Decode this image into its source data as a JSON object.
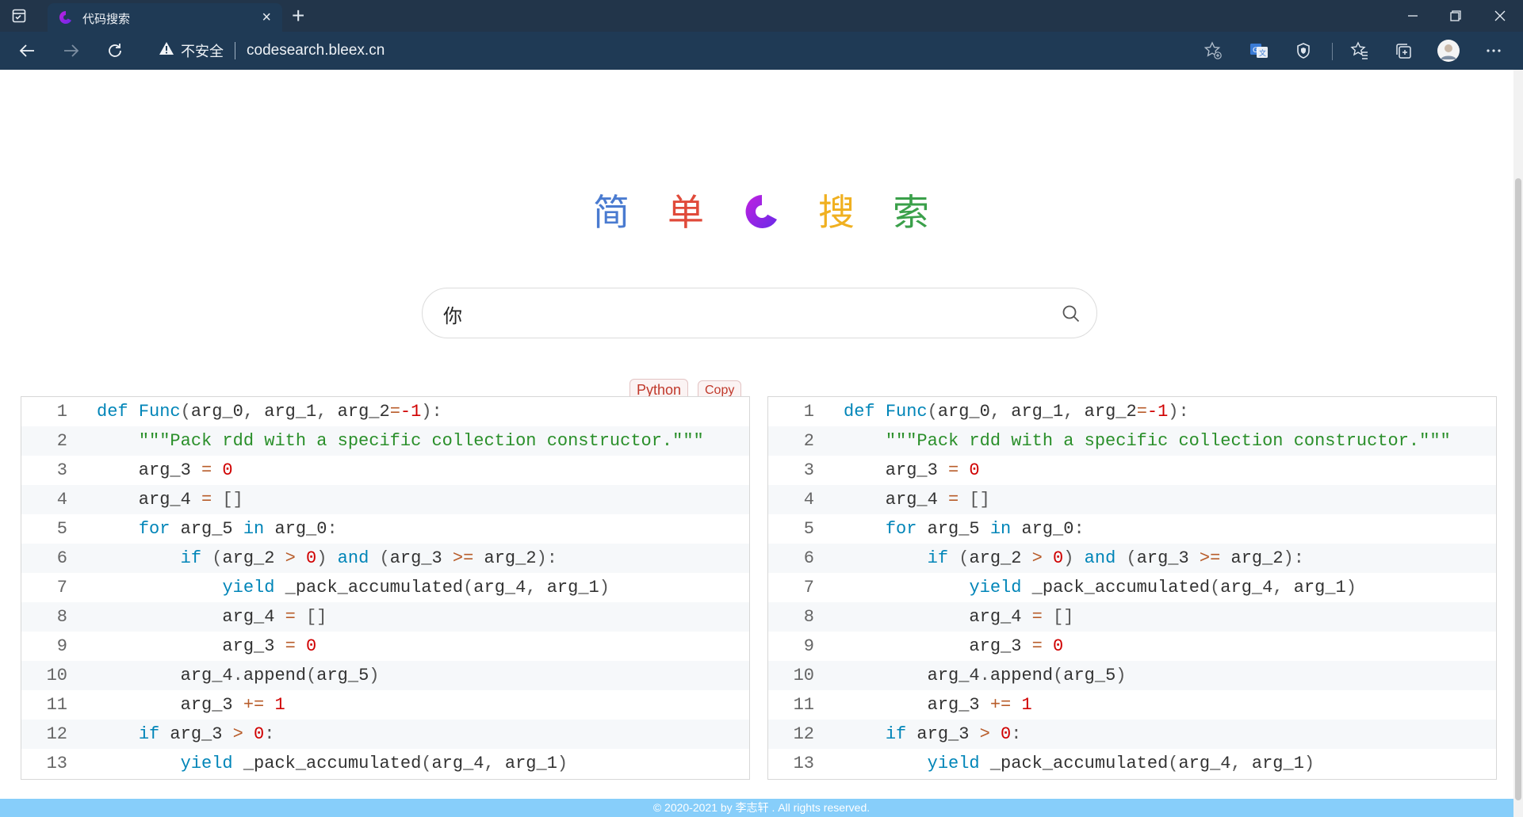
{
  "browser": {
    "tab": {
      "title": "代码搜索",
      "close_glyph": "×"
    },
    "new_tab_glyph": "+",
    "address": {
      "security_label": "不安全",
      "url": "codesearch.bleex.cn"
    },
    "icons": [
      "tab-actions-icon",
      "favicon-icon",
      "back-arrow-icon",
      "forward-arrow-icon",
      "refresh-icon",
      "warning-icon",
      "add-favorite-icon",
      "translate-icon",
      "shield-icon",
      "favorites-icon",
      "collections-icon",
      "profile-avatar-icon",
      "more-icon",
      "minimize-icon",
      "restore-icon",
      "close-icon"
    ],
    "colors": {
      "tab_bar": "#22354a",
      "toolbar": "#1f3a55"
    }
  },
  "logo": {
    "chars": [
      "简",
      "单",
      "搜",
      "索"
    ],
    "colors": [
      "#4a7bd0",
      "#e04a3a",
      "#f0b020",
      "#3aa04a"
    ],
    "icon_colors": {
      "start": "#c020e0",
      "end": "#6a2ae8"
    }
  },
  "search": {
    "value": "你",
    "placeholder": ""
  },
  "result": {
    "language": "Python",
    "copy_label": "Copy",
    "lines": [
      {
        "n": "1",
        "t": [
          [
            "kw",
            "def "
          ],
          [
            "fn",
            "Func"
          ],
          [
            "pn",
            "("
          ],
          [
            "",
            "arg_0"
          ],
          [
            "pn",
            ", "
          ],
          [
            "",
            "arg_1"
          ],
          [
            "pn",
            ", "
          ],
          [
            "",
            "arg_2"
          ],
          [
            "op",
            "="
          ],
          [
            "num",
            "-1"
          ],
          [
            "pn",
            "):"
          ]
        ]
      },
      {
        "n": "2",
        "t": [
          [
            "",
            "    "
          ],
          [
            "str",
            "\"\"\"Pack rdd with a specific collection constructor.\"\"\""
          ]
        ]
      },
      {
        "n": "3",
        "t": [
          [
            "",
            "    arg_3 "
          ],
          [
            "op",
            "="
          ],
          [
            "num",
            " 0"
          ]
        ]
      },
      {
        "n": "4",
        "t": [
          [
            "",
            "    arg_4 "
          ],
          [
            "op",
            "="
          ],
          [
            "pn",
            " []"
          ]
        ]
      },
      {
        "n": "5",
        "t": [
          [
            "",
            "    "
          ],
          [
            "kw",
            "for"
          ],
          [
            "",
            " arg_5 "
          ],
          [
            "kw",
            "in"
          ],
          [
            "",
            " arg_0"
          ],
          [
            "pn",
            ":"
          ]
        ]
      },
      {
        "n": "6",
        "t": [
          [
            "",
            "        "
          ],
          [
            "kw",
            "if"
          ],
          [
            "pn",
            " ("
          ],
          [
            "",
            "arg_2 "
          ],
          [
            "op",
            ">"
          ],
          [
            "num",
            " 0"
          ],
          [
            "pn",
            ") "
          ],
          [
            "kw",
            "and"
          ],
          [
            "pn",
            " ("
          ],
          [
            "",
            "arg_3 "
          ],
          [
            "op",
            ">="
          ],
          [
            "",
            " arg_2"
          ],
          [
            "pn",
            "):"
          ]
        ]
      },
      {
        "n": "7",
        "t": [
          [
            "",
            "            "
          ],
          [
            "kw",
            "yield"
          ],
          [
            "",
            " _pack_accumulated"
          ],
          [
            "pn",
            "("
          ],
          [
            "",
            "arg_4"
          ],
          [
            "pn",
            ", "
          ],
          [
            "",
            "arg_1"
          ],
          [
            "pn",
            ")"
          ]
        ]
      },
      {
        "n": "8",
        "t": [
          [
            "",
            "            arg_4 "
          ],
          [
            "op",
            "="
          ],
          [
            "pn",
            " []"
          ]
        ]
      },
      {
        "n": "9",
        "t": [
          [
            "",
            "            arg_3 "
          ],
          [
            "op",
            "="
          ],
          [
            "num",
            " 0"
          ]
        ]
      },
      {
        "n": "10",
        "t": [
          [
            "",
            "        arg_4"
          ],
          [
            "pn",
            "."
          ],
          [
            "",
            "append"
          ],
          [
            "pn",
            "("
          ],
          [
            "",
            "arg_5"
          ],
          [
            "pn",
            ")"
          ]
        ]
      },
      {
        "n": "11",
        "t": [
          [
            "",
            "        arg_3 "
          ],
          [
            "op",
            "+="
          ],
          [
            "num",
            " 1"
          ]
        ]
      },
      {
        "n": "12",
        "t": [
          [
            "",
            "    "
          ],
          [
            "kw",
            "if"
          ],
          [
            "",
            " arg_3 "
          ],
          [
            "op",
            ">"
          ],
          [
            "num",
            " 0"
          ],
          [
            "pn",
            ":"
          ]
        ]
      },
      {
        "n": "13",
        "t": [
          [
            "",
            "        "
          ],
          [
            "kw",
            "yield"
          ],
          [
            "",
            " _pack_accumulated"
          ],
          [
            "pn",
            "("
          ],
          [
            "",
            "arg_4"
          ],
          [
            "pn",
            ", "
          ],
          [
            "",
            "arg_1"
          ],
          [
            "pn",
            ")"
          ]
        ]
      }
    ]
  },
  "footer": {
    "text": "© 2020-2021 by 李志轩 . All rights reserved."
  }
}
